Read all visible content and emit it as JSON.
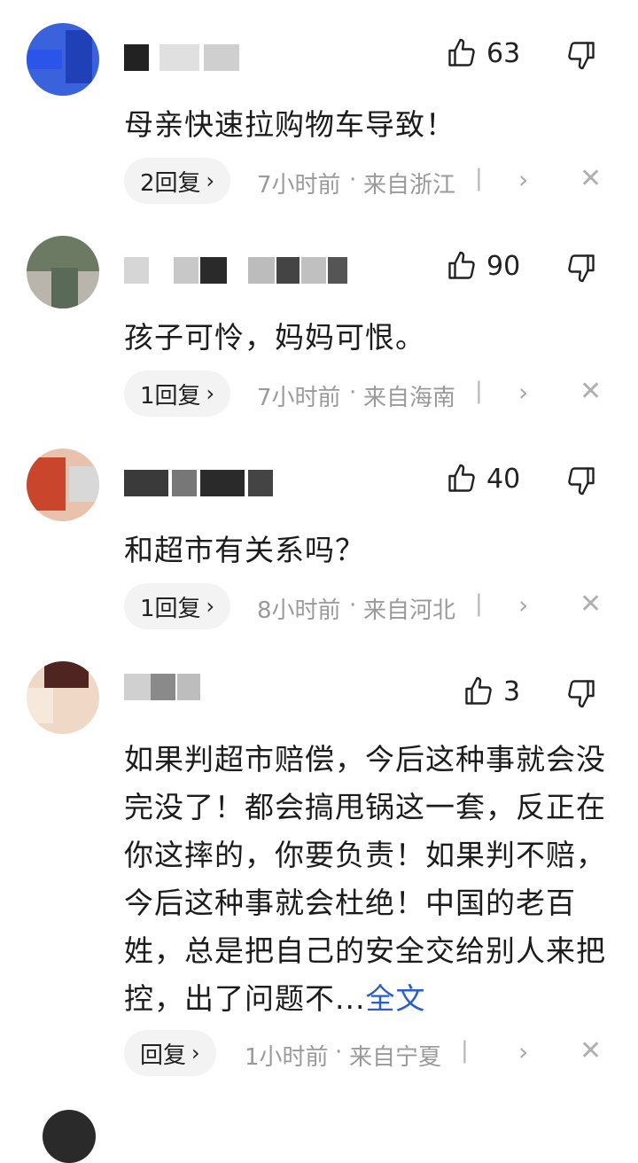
{
  "comments": [
    {
      "likes": "63",
      "content": "母亲快速拉购物车导致！",
      "reply_label": "2回复",
      "time": "7小时前",
      "location": "来自浙江",
      "avatar_colors": [
        "#2f5fe0",
        "#1d3fc0"
      ]
    },
    {
      "likes": "90",
      "content": "孩子可怜，妈妈可恨。",
      "reply_label": "1回复",
      "time": "7小时前",
      "location": "来自海南",
      "avatar_colors": [
        "#6a7a60",
        "#b8b0a8"
      ]
    },
    {
      "likes": "40",
      "content": "和超市有关系吗？",
      "reply_label": "1回复",
      "time": "8小时前",
      "location": "来自河北",
      "avatar_colors": [
        "#c0402a",
        "#e6b6a0"
      ]
    },
    {
      "likes": "3",
      "content": "如果判超市赔偿，今后这种事就会没完没了！都会搞甩锅这一套，反正在你这摔的，你要负责！如果判不赔，今后这种事就会杜绝！中国的老百姓，总是把自己的安全交给别人来把控，出了问题不...",
      "more_label": "全文",
      "reply_label": "回复",
      "time": "1小时前",
      "location": "来自宁夏",
      "avatar_colors": [
        "#5a2a22",
        "#e0c0a8"
      ]
    }
  ],
  "meta_dot": "·",
  "meta_separator": "|",
  "chevron": "›",
  "close_glyph": "✕"
}
